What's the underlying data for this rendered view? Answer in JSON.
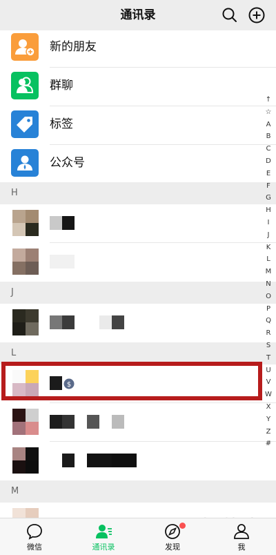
{
  "header": {
    "title": "通讯录",
    "search_icon": "search-icon",
    "add_icon": "plus-circle-icon"
  },
  "functions": [
    {
      "label": "新的朋友",
      "icon": "add-friend-icon",
      "color": "#fa9d3b"
    },
    {
      "label": "群聊",
      "icon": "group-chat-icon",
      "color": "#07c160"
    },
    {
      "label": "标签",
      "icon": "tag-icon",
      "color": "#2782d7"
    },
    {
      "label": "公众号",
      "icon": "official-account-icon",
      "color": "#2782d7"
    }
  ],
  "sections": {
    "h": "H",
    "j": "J",
    "l": "L",
    "m": "M"
  },
  "index_bar": [
    "↑",
    "☆",
    "A",
    "B",
    "C",
    "D",
    "E",
    "F",
    "G",
    "H",
    "I",
    "J",
    "K",
    "L",
    "M",
    "N",
    "O",
    "P",
    "Q",
    "R",
    "S",
    "T",
    "U",
    "V",
    "W",
    "X",
    "Y",
    "Z",
    "#"
  ],
  "tabs": [
    {
      "label": "微信",
      "icon": "chat-bubble-icon",
      "active": false
    },
    {
      "label": "通讯录",
      "icon": "contacts-icon",
      "active": true
    },
    {
      "label": "发现",
      "icon": "compass-icon",
      "active": false
    },
    {
      "label": "我",
      "icon": "person-icon",
      "active": false
    }
  ],
  "watermark": "智能家",
  "colors": {
    "accent": "#07c160",
    "highlight": "#b71c1c",
    "badge": "#fa5151"
  }
}
